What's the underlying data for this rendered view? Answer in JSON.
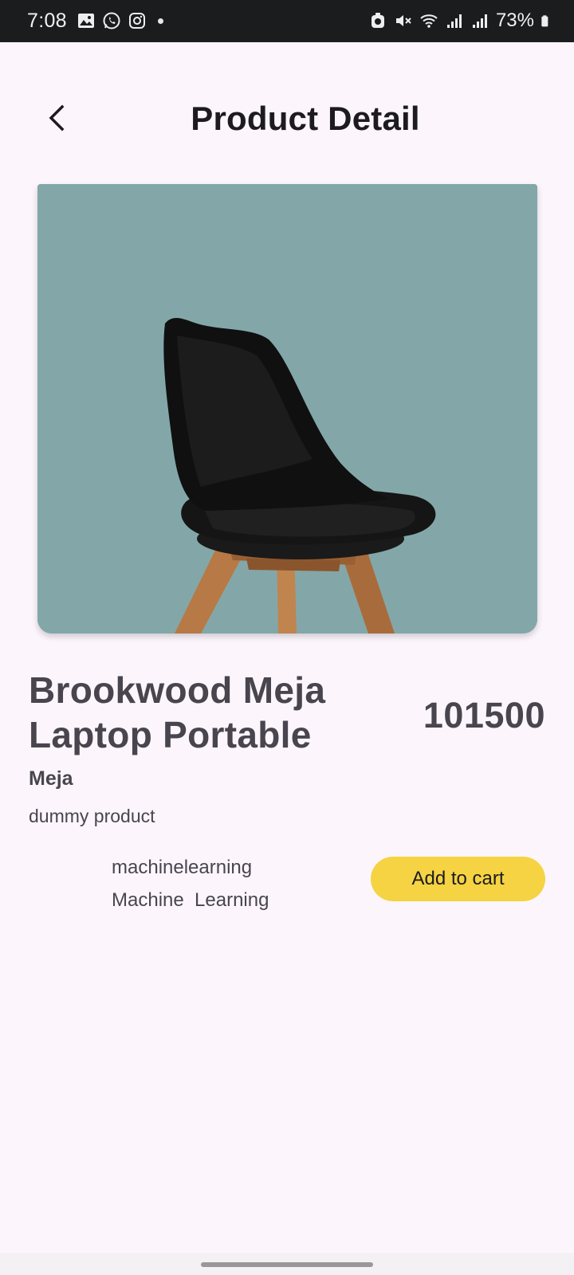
{
  "status_bar": {
    "time": "7:08",
    "left_icons": [
      "gallery-icon",
      "whatsapp-icon",
      "instagram-icon",
      "notification-dot-icon"
    ],
    "right_icons": [
      "accessibility-icon",
      "mute-icon",
      "wifi-icon",
      "signal-icon",
      "signal-icon",
      "battery-icon"
    ],
    "battery": "73%"
  },
  "app_bar": {
    "title": "Product Detail",
    "back_icon": "back-arrow-icon"
  },
  "product": {
    "image": "chair-product-image",
    "name": "Brookwood Meja Laptop Portable",
    "price": "101500",
    "category": "Meja",
    "description": "dummy product",
    "tags": [
      "machinelearning",
      "Machine  Learning"
    ],
    "add_to_cart_label": "Add to cart"
  },
  "colors": {
    "background": "#fcf6fc",
    "image_background": "#83a7a8",
    "button": "#f5d342",
    "text_muted": "#49454f"
  }
}
